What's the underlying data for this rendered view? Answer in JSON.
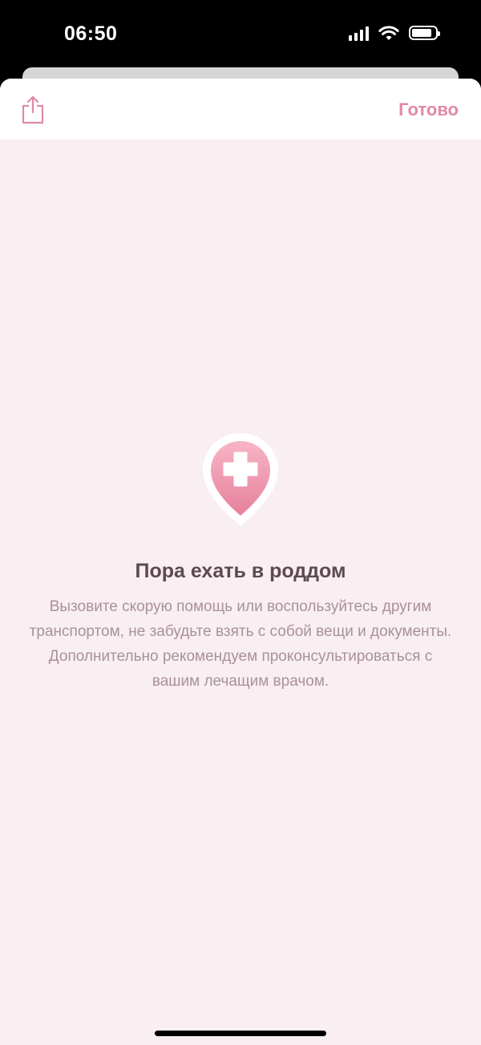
{
  "status_bar": {
    "time": "06:50",
    "icons": [
      "cellular-signal-icon",
      "wifi-icon",
      "battery-icon"
    ]
  },
  "header": {
    "share_icon": "share-icon",
    "done_label": "Готово"
  },
  "empty_state": {
    "icon": "medical-pin-icon",
    "title": "Пора ехать в роддом",
    "text": "Вызовите скорую помощь или воспользуйтесь другим транспортом, не забудьте взять с собой вещи и документы. Дополнительно рекомендуем проконсультироваться с вашим лечащим врачом."
  },
  "colors": {
    "accent": "#e08aa3",
    "background": "#f9eef1",
    "title": "#5b4a50",
    "body_text": "#a89298"
  }
}
